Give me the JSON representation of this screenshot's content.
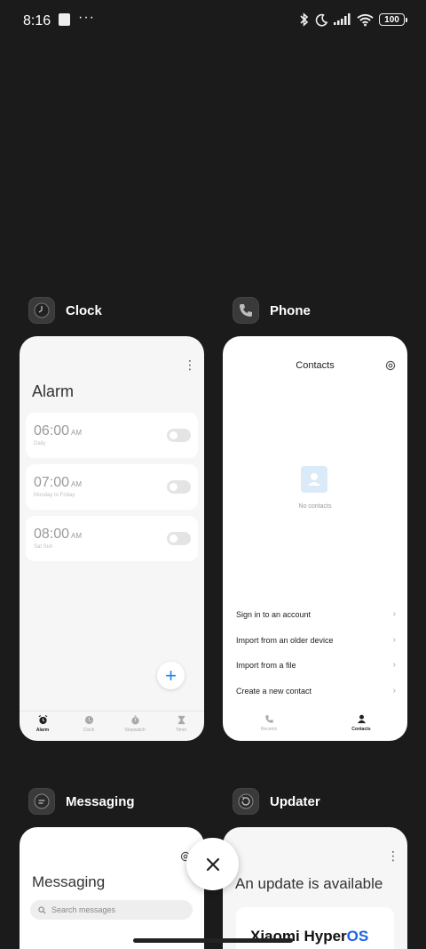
{
  "status_bar": {
    "time": "8:16",
    "more": "···",
    "battery": "100"
  },
  "apps": [
    {
      "name": "Clock",
      "icon": "clock-icon",
      "alarm_title": "Alarm",
      "alarms": [
        {
          "time": "06:00",
          "ampm": "AM",
          "repeat": "Daily",
          "enabled": false
        },
        {
          "time": "07:00",
          "ampm": "AM",
          "repeat": "Monday to Friday",
          "enabled": false
        },
        {
          "time": "08:00",
          "ampm": "AM",
          "repeat": "Sat Sun",
          "enabled": false
        }
      ],
      "add_label": "+",
      "tabs": [
        {
          "label": "Alarm",
          "icon": "alarm-icon",
          "active": true
        },
        {
          "label": "Clock",
          "icon": "clock-icon",
          "active": false
        },
        {
          "label": "Stopwatch",
          "icon": "stopwatch-icon",
          "active": false
        },
        {
          "label": "Timer",
          "icon": "hourglass-icon",
          "active": false
        }
      ]
    },
    {
      "name": "Phone",
      "icon": "phone-icon",
      "title": "Contacts",
      "empty_text": "No contacts",
      "options": [
        "Sign in to an account",
        "Import from an older device",
        "Import from a file",
        "Create a new contact"
      ],
      "tabs": [
        {
          "label": "Recents",
          "icon": "phone-icon",
          "active": false
        },
        {
          "label": "Contacts",
          "icon": "person-icon",
          "active": true
        }
      ]
    },
    {
      "name": "Messaging",
      "icon": "chat-icon",
      "title": "Messaging",
      "search_placeholder": "Search messages"
    },
    {
      "name": "Updater",
      "icon": "update-icon",
      "title": "An update is available",
      "brand_a": "Xiaomi Hyper",
      "brand_b": "OS"
    }
  ],
  "close_label": "×",
  "colors": {
    "background": "#1b1b1b",
    "accent": "#1f88e5",
    "brand_os": "#1c62e6"
  }
}
